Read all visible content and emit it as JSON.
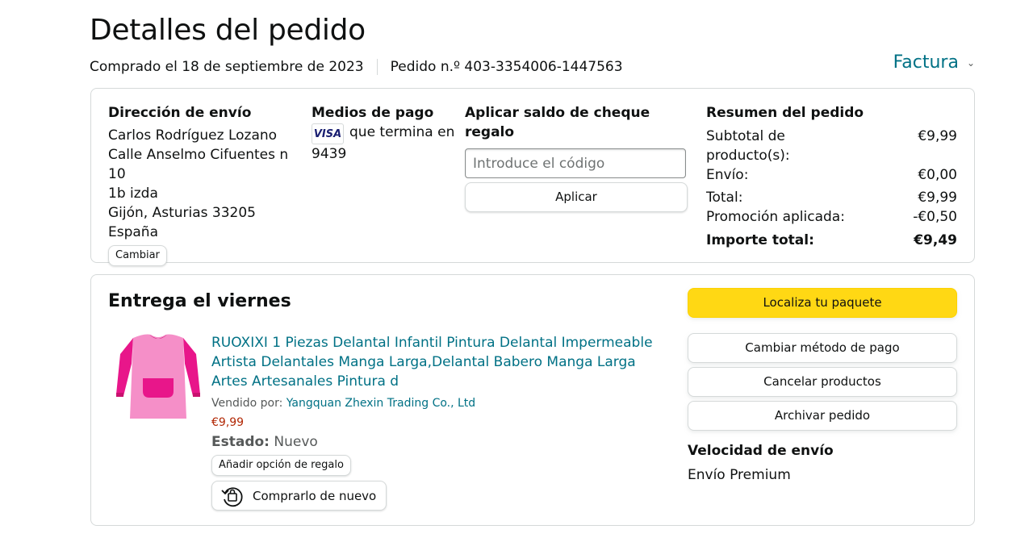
{
  "header": {
    "title": "Detalles del pedido",
    "purchased": "Comprado el 18 de septiembre de 2023",
    "order_number": "Pedido n.º 403-3354006-1447563",
    "invoice_label": "Factura"
  },
  "shipping": {
    "title": "Dirección de envío",
    "name": "Carlos Rodríguez Lozano",
    "street": "Calle Anselmo Cifuentes n 10",
    "street2": "1b izda",
    "city": "Gijón, Asturias 33205",
    "country": "España",
    "change_label": "Cambiar"
  },
  "payment": {
    "title": "Medios de pago",
    "card_brand": "VISA",
    "ending_text": "que termina en",
    "last_digits": "9439"
  },
  "gift_card": {
    "title": "Aplicar saldo de cheque regalo",
    "placeholder": "Introduce el código",
    "apply_label": "Aplicar"
  },
  "summary": {
    "title": "Resumen del pedido",
    "rows": [
      {
        "label": "Subtotal de producto(s):",
        "value": "€9,99"
      },
      {
        "label": "Envío:",
        "value": "€0,00"
      },
      {
        "label": "Total:",
        "value": "€9,99"
      },
      {
        "label": "Promoción aplicada:",
        "value": "-€0,50"
      }
    ],
    "grand_total": {
      "label": "Importe total:",
      "value": "€9,49"
    }
  },
  "delivery": {
    "title": "Entrega el viernes",
    "product": {
      "title": "RUOXIXI 1 Piezas Delantal Infantil Pintura Delantal Impermeable Artista Delantales Manga Larga,Delantal Babero Manga Larga Artes Artesanales Pintura d",
      "sold_by_label": "Vendido por:",
      "seller": "Yangquan Zhexin Trading Co., Ltd",
      "price": "€9,99",
      "condition_label": "Estado:",
      "condition": "Nuevo",
      "gift_option_label": "Añadir opción de regalo",
      "buy_again_label": "Comprarlo de nuevo"
    },
    "actions": {
      "track": "Localiza tu paquete",
      "change_payment": "Cambiar método de pago",
      "cancel": "Cancelar productos",
      "archive": "Archivar pedido"
    },
    "speed_title": "Velocidad de envío",
    "speed_value": "Envío Premium"
  },
  "colors": {
    "link": "#007185",
    "price": "#b12704",
    "primary_button": "#ffd814",
    "border": "#d5d9d9"
  },
  "icons": {
    "invoice_chevron": "chevron-down-icon",
    "buy_again": "buy-again-icon",
    "card": "visa-icon"
  }
}
